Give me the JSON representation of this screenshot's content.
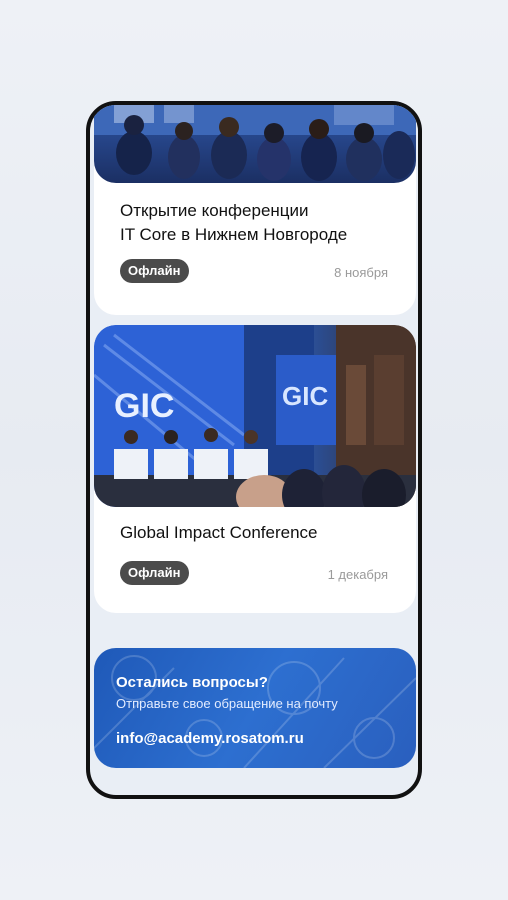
{
  "events": [
    {
      "title": "Открытие конференции\nIT Core в Нижнем Новгороде",
      "badge": "Офлайн",
      "date": "8 ноября",
      "image": "conference-audience-photo"
    },
    {
      "title": "Global Impact Conference",
      "badge": "Офлайн",
      "date": "1 декабря",
      "image": "panel-discussion-photo"
    }
  ],
  "contact_banner": {
    "title": "Остались вопросы?",
    "subtitle": "Отправьте свое обращение на почту",
    "email": "info@academy.rosatom.ru"
  },
  "colors": {
    "badge_bg": "#4b4b4b",
    "banner_blue": "#2d6fd0",
    "phone_frame": "#111111"
  }
}
